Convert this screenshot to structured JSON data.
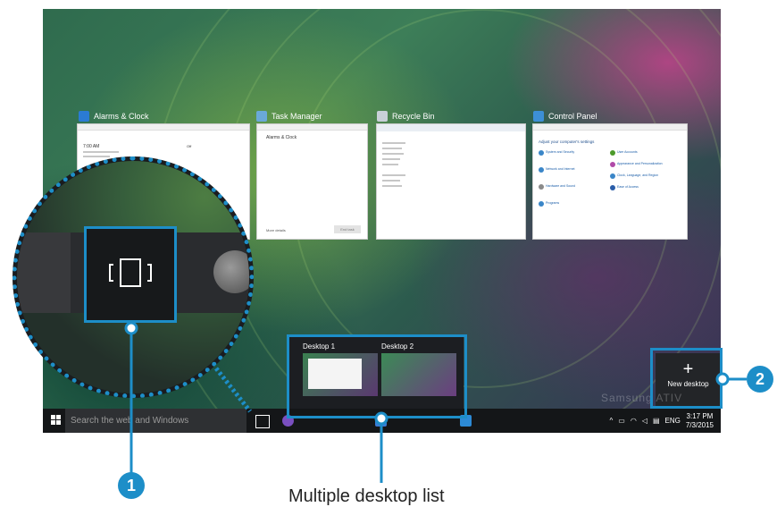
{
  "windows": [
    {
      "title": "Alarms & Clock",
      "icon": "alarm-clock-icon"
    },
    {
      "title": "Task Manager",
      "icon": "task-manager-icon"
    },
    {
      "title": "Recycle Bin",
      "icon": "recycle-bin-icon"
    },
    {
      "title": "Control Panel",
      "icon": "control-panel-icon"
    }
  ],
  "task_manager": {
    "item": "Alarms & Clock",
    "more_details": "More details",
    "end_task": "End task"
  },
  "alarms": {
    "time": "7:00 AM",
    "toggle": "Off"
  },
  "control_panel": {
    "heading": "Adjust your computer's settings",
    "categories": [
      "System and Security",
      "Network and Internet",
      "Hardware and Sound",
      "Programs",
      "User Accounts",
      "Appearance and Personalization",
      "Clock, Language, and Region",
      "Ease of Access"
    ]
  },
  "desktops": [
    {
      "label": "Desktop 1"
    },
    {
      "label": "Desktop 2"
    }
  ],
  "new_desktop": {
    "label": "New desktop",
    "plus": "+"
  },
  "taskbar": {
    "search_placeholder": "Search the web and Windows",
    "language": "ENG",
    "time": "3:17 PM",
    "date": "7/3/2015"
  },
  "watermark": "Samsung ATIV",
  "callouts": {
    "one": "1",
    "two": "2"
  },
  "caption": "Multiple desktop list",
  "colors": {
    "accent": "#1d8ec8",
    "taskbar": "#141618"
  }
}
